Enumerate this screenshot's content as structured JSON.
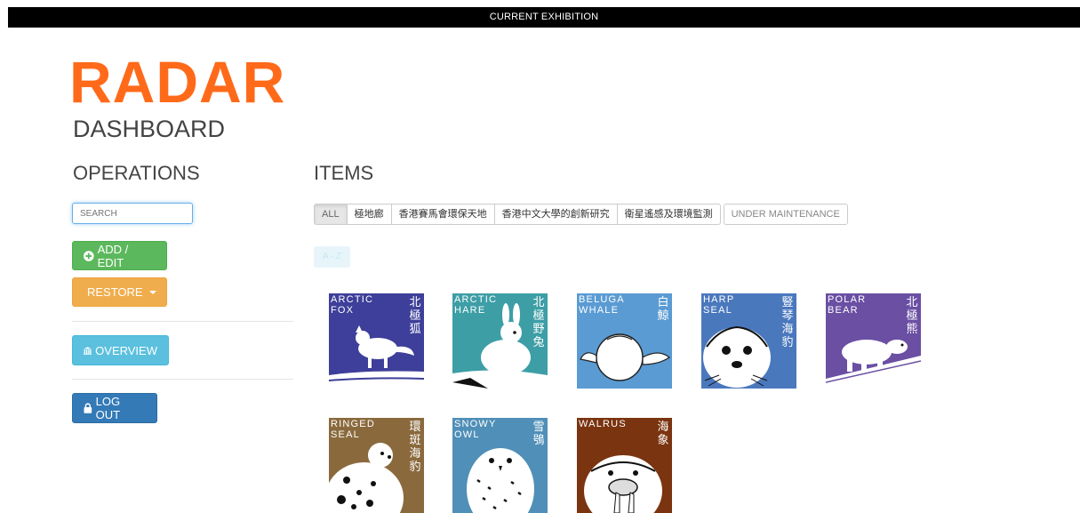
{
  "topbar": {
    "label": "CURRENT EXHIBITION"
  },
  "brand": {
    "logo": "RADAR",
    "subtitle": "DASHBOARD",
    "color": "#ff6a1a"
  },
  "operations": {
    "heading": "OPERATIONS",
    "search_placeholder": "SEARCH",
    "add_label": "ADD / EDIT",
    "restore_label": "RESTORE",
    "overview_label": "OVERVIEW",
    "logout_label": "LOG OUT"
  },
  "items": {
    "heading": "ITEMS",
    "filters": [
      "ALL",
      "極地廊",
      "香港賽馬會環保天地",
      "香港中文大學的創新研究",
      "衛星遙感及環境監測",
      "UNDER MAINTENANCE"
    ],
    "active_filter": "ALL",
    "sort_label": "A - Z",
    "tiles": [
      {
        "en": "ARCTIC\nFOX",
        "zh": "北極狐",
        "bg": "#3d3f9a",
        "icon": "arctic-fox-icon"
      },
      {
        "en": "ARCTIC\nHARE",
        "zh": "北極野兔",
        "bg": "#3d9ea6",
        "icon": "arctic-hare-icon"
      },
      {
        "en": "BELUGA\nWHALE",
        "zh": "白鯨",
        "bg": "#5b9bd3",
        "icon": "beluga-whale-icon"
      },
      {
        "en": "HARP\nSEAL",
        "zh": "豎琴海豹",
        "bg": "#4a78bd",
        "icon": "harp-seal-icon"
      },
      {
        "en": "POLAR\nBEAR",
        "zh": "北極熊",
        "bg": "#6a4fa3",
        "icon": "polar-bear-icon"
      },
      {
        "en": "RINGED\nSEAL",
        "zh": "環斑海豹",
        "bg": "#8a6a3d",
        "icon": "ringed-seal-icon"
      },
      {
        "en": "SNOWY\nOWL",
        "zh": "雪鴞",
        "bg": "#4f8fb8",
        "icon": "snowy-owl-icon"
      },
      {
        "en": "WALRUS",
        "zh": "海象",
        "bg": "#7a3410",
        "icon": "walrus-icon"
      }
    ]
  }
}
